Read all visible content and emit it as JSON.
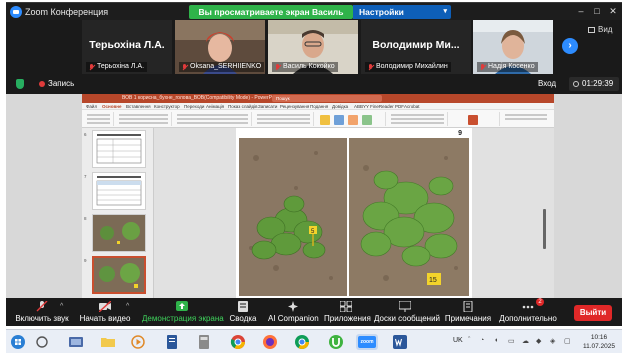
{
  "window": {
    "app_title": "Zoom Конференция",
    "share_banner": "Вы просматриваете экран Василь Кокойко",
    "view_options_label": "Настройки просмотра",
    "controls": [
      "–",
      "□",
      "✕"
    ]
  },
  "video_strip": {
    "tiles": [
      {
        "big_name": "Терьохіна Л.А.",
        "label": "Терьохіна Л.А.",
        "has_video": false
      },
      {
        "big_name": "",
        "label": "Oksana_SERHIIENKO",
        "has_video": true
      },
      {
        "big_name": "",
        "label": "Василь Кокойко",
        "has_video": true
      },
      {
        "big_name": "Володимир Ми...",
        "label": "Володимир Михайлин",
        "has_video": false
      },
      {
        "big_name": "",
        "label": "Надія Косенко",
        "has_video": true
      }
    ],
    "next_page_symbol": "›",
    "view_label": "Вид"
  },
  "info_bar": {
    "record_label": "Запись",
    "exit_label": "Вход",
    "timer": "01:29:39"
  },
  "shared_screen": {
    "ppt_title": "ВОВ 1 корисна_бухне_голова_ВОВ(Compatibility Mode) - PowerPoint",
    "ppt_search": "Пошук",
    "ppt_menu": [
      "Файл",
      "Основне",
      "Вставлення",
      "Конструктор",
      "Переходи",
      "Анімація",
      "Показ слайдів",
      "Записати",
      "Рецензування",
      "Подання",
      "Довідка",
      "ABBYY FineReader PDF",
      "Acrobat"
    ],
    "slide_number": "9",
    "thumbnail_numbers": [
      "6",
      "7",
      "8",
      "9"
    ],
    "plant_labels": [
      "5",
      "15"
    ]
  },
  "toolbar": {
    "items": [
      {
        "label": "Включить звук",
        "icon": "mic-muted-icon"
      },
      {
        "label": "Начать видео",
        "icon": "video-off-icon"
      },
      {
        "label": "Демонстрация экрана",
        "icon": "share-screen-icon"
      },
      {
        "label": "Сводка",
        "icon": "summary-icon"
      },
      {
        "label": "AI Companion",
        "icon": "ai-sparkle-icon"
      },
      {
        "label": "Приложения",
        "icon": "apps-icon"
      },
      {
        "label": "Доски сообщений",
        "icon": "whiteboard-icon"
      },
      {
        "label": "Примечания",
        "icon": "notes-icon"
      },
      {
        "label": "Дополнительно",
        "icon": "more-icon"
      }
    ],
    "more_badge": "2",
    "leave_label": "Выйти",
    "colors": {
      "share_green": "#2fb34a",
      "leave_red": "#e02828"
    }
  },
  "taskbar": {
    "lang": "UK",
    "time": "10:16",
    "date": "11.07.2025",
    "apps": [
      "start-icon",
      "task-view-icon",
      "file-explorer-icon",
      "media-icon",
      "word-doc-icon",
      "calculator-icon",
      "app-icon",
      "chrome-icon",
      "firefox-icon",
      "chrome-alt-icon",
      "utorrent-icon",
      "zoom-icon",
      "word-icon"
    ],
    "zoom_label": "zoom"
  }
}
